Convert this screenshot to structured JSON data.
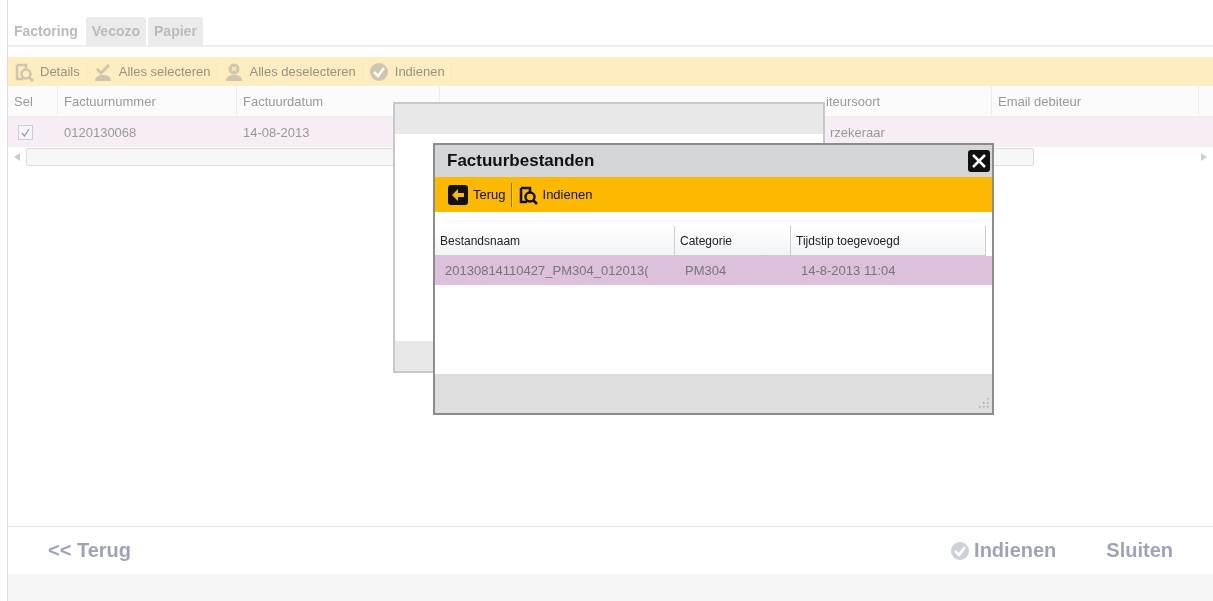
{
  "main": {
    "tabs": [
      {
        "label": "Factoring",
        "selected": true
      },
      {
        "label": "Vecozo",
        "selected": false
      },
      {
        "label": "Papier",
        "selected": false
      }
    ],
    "toolbar": [
      {
        "label": "Details",
        "kind": "details"
      },
      {
        "label": "Alles selecteren",
        "kind": "select"
      },
      {
        "label": "Alles deselecteren",
        "kind": "deselect"
      },
      {
        "label": "Indienen",
        "kind": "check"
      }
    ],
    "table": {
      "columns": [
        "Sel",
        "Factuurnummer",
        "Factuurdatum",
        "iteursoort",
        "Email debiteur"
      ],
      "rows": [
        {
          "checked": true,
          "selected": true,
          "cells": [
            "",
            "0120130068",
            "14-08-2013",
            "rzekeraar"
          ]
        }
      ]
    },
    "footer": {
      "back": "<< Terug",
      "submit": "Indienen",
      "close": "Sluiten"
    }
  },
  "dialog": {
    "title": "Factuurbestanden",
    "toolbar": [
      {
        "label": "Terug",
        "kind": "back"
      },
      {
        "label": "Indienen",
        "kind": "details"
      }
    ],
    "columns": [
      "Bestandsnaam",
      "Categorie",
      "Tijdstip toegevoegd"
    ],
    "rows": [
      {
        "selected": true,
        "cells": [
          "20130814110427_PM304_012013(",
          "PM304",
          "14-8-2013 11:04"
        ]
      }
    ]
  }
}
